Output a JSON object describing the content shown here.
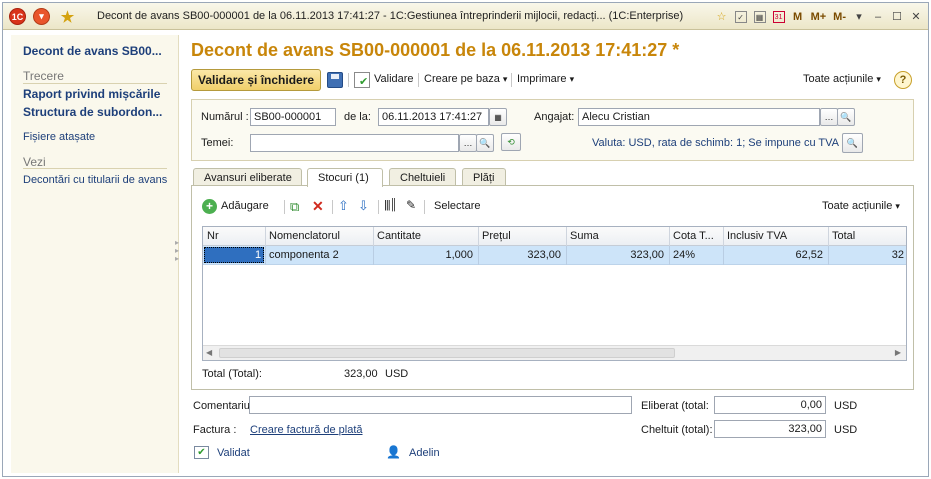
{
  "window": {
    "title": "Decont de avans SB00-000001 de la 06.11.2013 17:41:27 - 1C:Gestiunea întreprinderii mijlocii, redacți...  (1C:Enterprise)",
    "icons": [
      "1c-logo-icon",
      "menu-dropdown-icon",
      "favorite-star-icon"
    ],
    "right_icons": [
      "add-favorite-icon",
      "bookmark-icon",
      "calculator-icon",
      "calendar-icon"
    ],
    "mem_labels": [
      "M",
      "M+",
      "M-"
    ],
    "window_controls": [
      "minimize",
      "maximize",
      "close"
    ]
  },
  "left_panel": {
    "current": "Decont de avans SB00...",
    "section_trecere": "Trecere",
    "trecere_items": [
      "Raport privind mișcările",
      "Structura de subordon..."
    ],
    "attached": "Fișiere atașate",
    "section_vezi": "Vezi",
    "vezi_items": [
      "Decontări cu titularii de avans"
    ]
  },
  "document": {
    "title": "Decont de avans SB00-000001 de la 06.11.2013 17:41:27 *"
  },
  "toolbar": {
    "save_close": "Validare și închidere",
    "validate": "Validare",
    "create_on_base": "Creare pe baza",
    "print": "Imprimare",
    "all_actions": "Toate acțiunile"
  },
  "header": {
    "number_label": "Numărul :",
    "number_value": "SB00-000001",
    "date_label": "de la:",
    "date_value": "06.11.2013 17:41:27",
    "employee_label": "Angajat:",
    "employee_value": "Alecu Cristian",
    "topic_label": "Temei:",
    "topic_value": "",
    "currency_info": "Valuta: USD, rata de schimb: 1; Se impune cu TVA"
  },
  "tabs": [
    {
      "label": "Avansuri eliberate",
      "active": false
    },
    {
      "label": "Stocuri  (1)",
      "active": true
    },
    {
      "label": "Cheltuieli",
      "active": false
    },
    {
      "label": "Plăți",
      "active": false
    }
  ],
  "table_toolbar": {
    "add": "Adăugare",
    "select": "Selectare",
    "all_actions": "Toate acțiunile"
  },
  "table": {
    "columns": [
      "Nr",
      "Nomenclatorul",
      "Cantitate",
      "Prețul",
      "Suma",
      "Cota T...",
      "Inclusiv TVA",
      "Total"
    ],
    "rows": [
      {
        "nr": "1",
        "item": "componenta 2",
        "qty": "1,000",
        "price": "323,00",
        "sum": "323,00",
        "vat_rate": "24%",
        "vat": "62,52",
        "total": "32"
      }
    ]
  },
  "totals": {
    "label": "Total (Total):",
    "value": "323,00",
    "currency": "USD"
  },
  "footer": {
    "comment_label": "Comentariu:",
    "comment_value": "",
    "issued_label": "Eliberat (total:",
    "issued_value": "0,00",
    "issued_currency": "USD",
    "invoice_label": "Factura :",
    "invoice_link": "Creare factură de plată",
    "spent_label": "Cheltuit (total):",
    "spent_value": "323,00",
    "spent_currency": "USD",
    "status": "Validat",
    "author": "Adelin"
  }
}
